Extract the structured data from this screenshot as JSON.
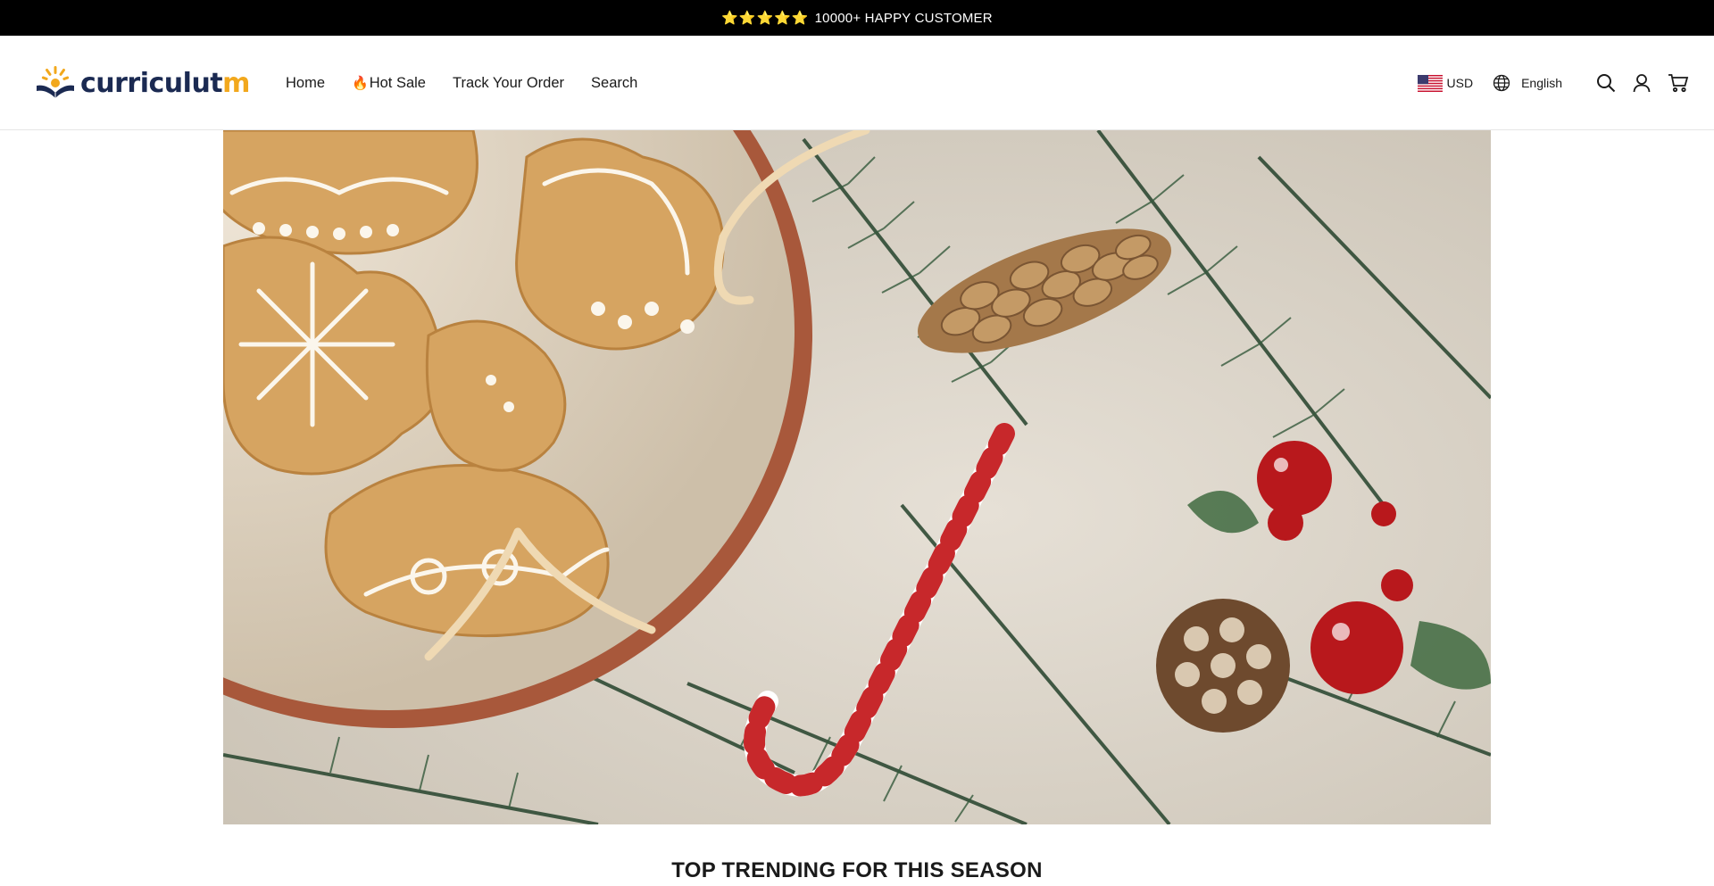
{
  "announcement": {
    "stars": "⭐⭐⭐⭐⭐",
    "text": "10000+ HAPPY CUSTOMER"
  },
  "logo": {
    "text_main": "curriculut",
    "text_accent": "m"
  },
  "nav": {
    "items": [
      {
        "label": "Home"
      },
      {
        "label": "Hot Sale",
        "icon": "fire-icon"
      },
      {
        "label": "Track Your Order"
      },
      {
        "label": "Search"
      }
    ]
  },
  "header": {
    "currency": "USD",
    "language": "English",
    "icons": [
      "globe-icon",
      "search-icon",
      "account-icon",
      "cart-icon"
    ]
  },
  "hero": {
    "image": "christmas-cookies-pine-cones-candy-cane"
  },
  "section": {
    "title": "TOP TRENDING FOR THIS SEASON"
  },
  "colors": {
    "announcement_bg": "#000000",
    "logo_navy": "#1b2a52",
    "logo_accent": "#f2a81d"
  }
}
